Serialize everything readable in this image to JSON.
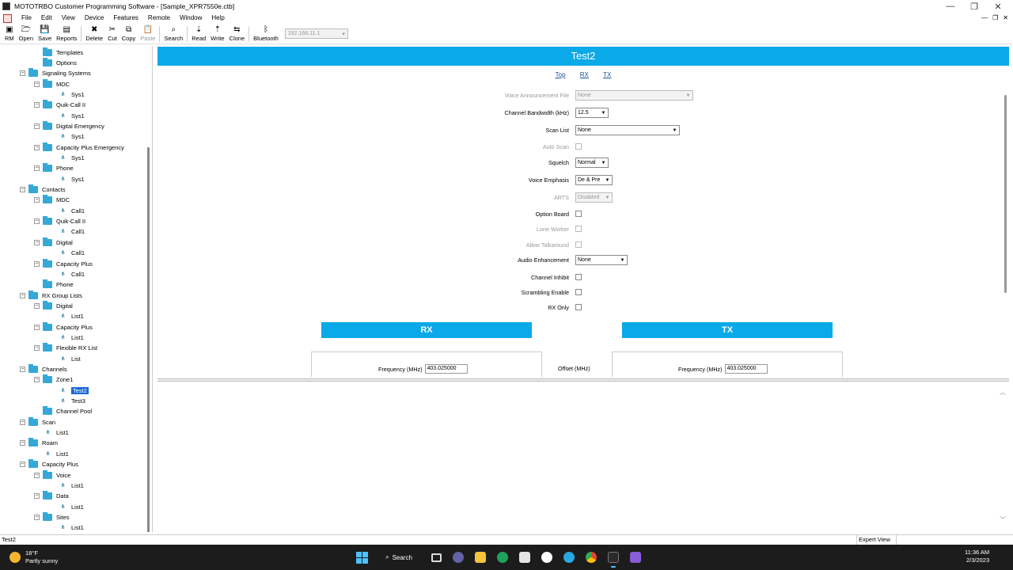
{
  "window": {
    "title": "MOTOTRBO Customer Programming Software - [Sample_XPR7550e.ctb]",
    "controls": [
      "—",
      "❐",
      "✕"
    ]
  },
  "menu": {
    "items": [
      "File",
      "Edit",
      "View",
      "Device",
      "Features",
      "Remote",
      "Window",
      "Help"
    ],
    "mdi_controls": [
      "—",
      "❐",
      "✕"
    ]
  },
  "toolbar": {
    "buttons": [
      {
        "label": "RM",
        "icon": "rm-icon",
        "glyph": "▣",
        "enabled": true
      },
      {
        "label": "Open",
        "icon": "open-folder-icon",
        "glyph": "🗁",
        "enabled": true
      },
      {
        "label": "Save",
        "icon": "save-icon",
        "glyph": "💾",
        "enabled": true
      },
      {
        "label": "Reports",
        "icon": "reports-icon",
        "glyph": "▤",
        "enabled": true
      },
      {
        "label": "Delete",
        "icon": "delete-icon",
        "glyph": "✖",
        "enabled": true
      },
      {
        "label": "Cut",
        "icon": "cut-icon",
        "glyph": "✂",
        "enabled": true
      },
      {
        "label": "Copy",
        "icon": "copy-icon",
        "glyph": "⧉",
        "enabled": true
      },
      {
        "label": "Paste",
        "icon": "paste-icon",
        "glyph": "📋",
        "enabled": false
      },
      {
        "label": "Search",
        "icon": "search-icon",
        "glyph": "⌕",
        "enabled": true
      },
      {
        "label": "Read",
        "icon": "read-icon",
        "glyph": "⇣",
        "enabled": true
      },
      {
        "label": "Write",
        "icon": "write-icon",
        "glyph": "⇡",
        "enabled": true
      },
      {
        "label": "Clone",
        "icon": "clone-icon",
        "glyph": "⇆",
        "enabled": true
      },
      {
        "label": "Bluetooth",
        "icon": "bluetooth-icon",
        "glyph": "ᛒ",
        "enabled": true
      }
    ],
    "ip_address": "192.168.11.1"
  },
  "tree": [
    {
      "label": "Templates",
      "level": 2,
      "type": "folder"
    },
    {
      "label": "Options",
      "level": 2,
      "type": "folder"
    },
    {
      "label": "Signaling Systems",
      "level": 1,
      "type": "folder",
      "expander": "−"
    },
    {
      "label": "MDC",
      "level": 2,
      "type": "folder",
      "expander": "−"
    },
    {
      "label": "Sys1",
      "level": 3,
      "type": "leaf"
    },
    {
      "label": "Quik-Call II",
      "level": 2,
      "type": "folder",
      "expander": "−"
    },
    {
      "label": "Sys1",
      "level": 3,
      "type": "leaf"
    },
    {
      "label": "Digital Emergency",
      "level": 2,
      "type": "folder",
      "expander": "−"
    },
    {
      "label": "Sys1",
      "level": 3,
      "type": "leaf"
    },
    {
      "label": "Capacity Plus Emergency",
      "level": 2,
      "type": "folder",
      "expander": "−"
    },
    {
      "label": "Sys1",
      "level": 3,
      "type": "leaf"
    },
    {
      "label": "Phone",
      "level": 2,
      "type": "folder",
      "expander": "−"
    },
    {
      "label": "Sys1",
      "level": 3,
      "type": "leaf"
    },
    {
      "label": "Contacts",
      "level": 1,
      "type": "folder",
      "expander": "−"
    },
    {
      "label": "MDC",
      "level": 2,
      "type": "folder",
      "expander": "−"
    },
    {
      "label": "Call1",
      "level": 3,
      "type": "leaf"
    },
    {
      "label": "Quik-Call II",
      "level": 2,
      "type": "folder",
      "expander": "−"
    },
    {
      "label": "Call1",
      "level": 3,
      "type": "leaf"
    },
    {
      "label": "Digital",
      "level": 2,
      "type": "folder",
      "expander": "−"
    },
    {
      "label": "Call1",
      "level": 3,
      "type": "leaf"
    },
    {
      "label": "Capacity Plus",
      "level": 2,
      "type": "folder",
      "expander": "−"
    },
    {
      "label": "Call1",
      "level": 3,
      "type": "leaf"
    },
    {
      "label": "Phone",
      "level": 2,
      "type": "folder"
    },
    {
      "label": "RX Group Lists",
      "level": 1,
      "type": "folder",
      "expander": "−"
    },
    {
      "label": "Digital",
      "level": 2,
      "type": "folder",
      "expander": "−"
    },
    {
      "label": "List1",
      "level": 3,
      "type": "leaf"
    },
    {
      "label": "Capacity Plus",
      "level": 2,
      "type": "folder",
      "expander": "−"
    },
    {
      "label": "List1",
      "level": 3,
      "type": "leaf"
    },
    {
      "label": "Flexible RX List",
      "level": 2,
      "type": "folder",
      "expander": "−"
    },
    {
      "label": "List",
      "level": 3,
      "type": "leaf"
    },
    {
      "label": "Channels",
      "level": 1,
      "type": "folder",
      "expander": "−"
    },
    {
      "label": "Zone1",
      "level": 2,
      "type": "folder",
      "expander": "−"
    },
    {
      "label": "Test2",
      "level": 3,
      "type": "leaf",
      "selected": true
    },
    {
      "label": "Test3",
      "level": 3,
      "type": "leaf"
    },
    {
      "label": "Channel Pool",
      "level": 2,
      "type": "folder"
    },
    {
      "label": "Scan",
      "level": 1,
      "type": "folder",
      "expander": "−"
    },
    {
      "label": "List1",
      "level": 2,
      "type": "leaf"
    },
    {
      "label": "Roam",
      "level": 1,
      "type": "folder",
      "expander": "−"
    },
    {
      "label": "List1",
      "level": 2,
      "type": "leaf"
    },
    {
      "label": "Capacity Plus",
      "level": 1,
      "type": "folder",
      "expander": "−"
    },
    {
      "label": "Voice",
      "level": 2,
      "type": "folder",
      "expander": "−"
    },
    {
      "label": "List1",
      "level": 3,
      "type": "leaf"
    },
    {
      "label": "Data",
      "level": 2,
      "type": "folder",
      "expander": "−"
    },
    {
      "label": "List1",
      "level": 3,
      "type": "leaf"
    },
    {
      "label": "Sites",
      "level": 2,
      "type": "folder",
      "expander": "−"
    },
    {
      "label": "List1",
      "level": 3,
      "type": "leaf"
    }
  ],
  "channel": {
    "title": "Test2",
    "links": {
      "top": "Top",
      "rx": "RX",
      "tx": "TX"
    },
    "fields": {
      "voice_announcement": {
        "label": "Voice Announcement File",
        "value": "None"
      },
      "bandwidth": {
        "label": "Channel Bandwidth (kHz)",
        "value": "12.5"
      },
      "scan_list": {
        "label": "Scan List",
        "value": "None"
      },
      "auto_scan": {
        "label": "Auto Scan"
      },
      "squelch": {
        "label": "Squelch",
        "value": "Normal"
      },
      "voice_emphasis": {
        "label": "Voice Emphasis",
        "value": "De & Pre"
      },
      "arts": {
        "label": "ARTS",
        "value": "Disabled"
      },
      "option_board": {
        "label": "Option Board"
      },
      "lone_worker": {
        "label": "Lone Worker"
      },
      "allow_talkaround": {
        "label": "Allow Talkaround"
      },
      "audio_enhancement": {
        "label": "Audio Enhancement",
        "value": "None"
      },
      "channel_inhibit": {
        "label": "Channel Inhibit"
      },
      "scrambling": {
        "label": "Scrambling Enable"
      },
      "rx_only": {
        "label": "RX Only"
      }
    },
    "rx": {
      "title": "RX",
      "freq_label": "Frequency (MHz)",
      "freq_value": "403.025000"
    },
    "offset_label": "Offset (MHz)",
    "tx": {
      "title": "TX",
      "freq_label": "Frequency (MHz)",
      "freq_value": "403.025000"
    }
  },
  "status": {
    "left": "Test2",
    "mode": "Expert View"
  },
  "taskbar": {
    "weather_temp": "18°F",
    "weather_desc": "Partly sunny",
    "search_label": "Search",
    "time": "11:36 AM",
    "date": "2/3/2023"
  },
  "colors": {
    "accent": "#0aa9e8",
    "selection": "#1a68d8",
    "taskbar": "#1c1c1c"
  }
}
